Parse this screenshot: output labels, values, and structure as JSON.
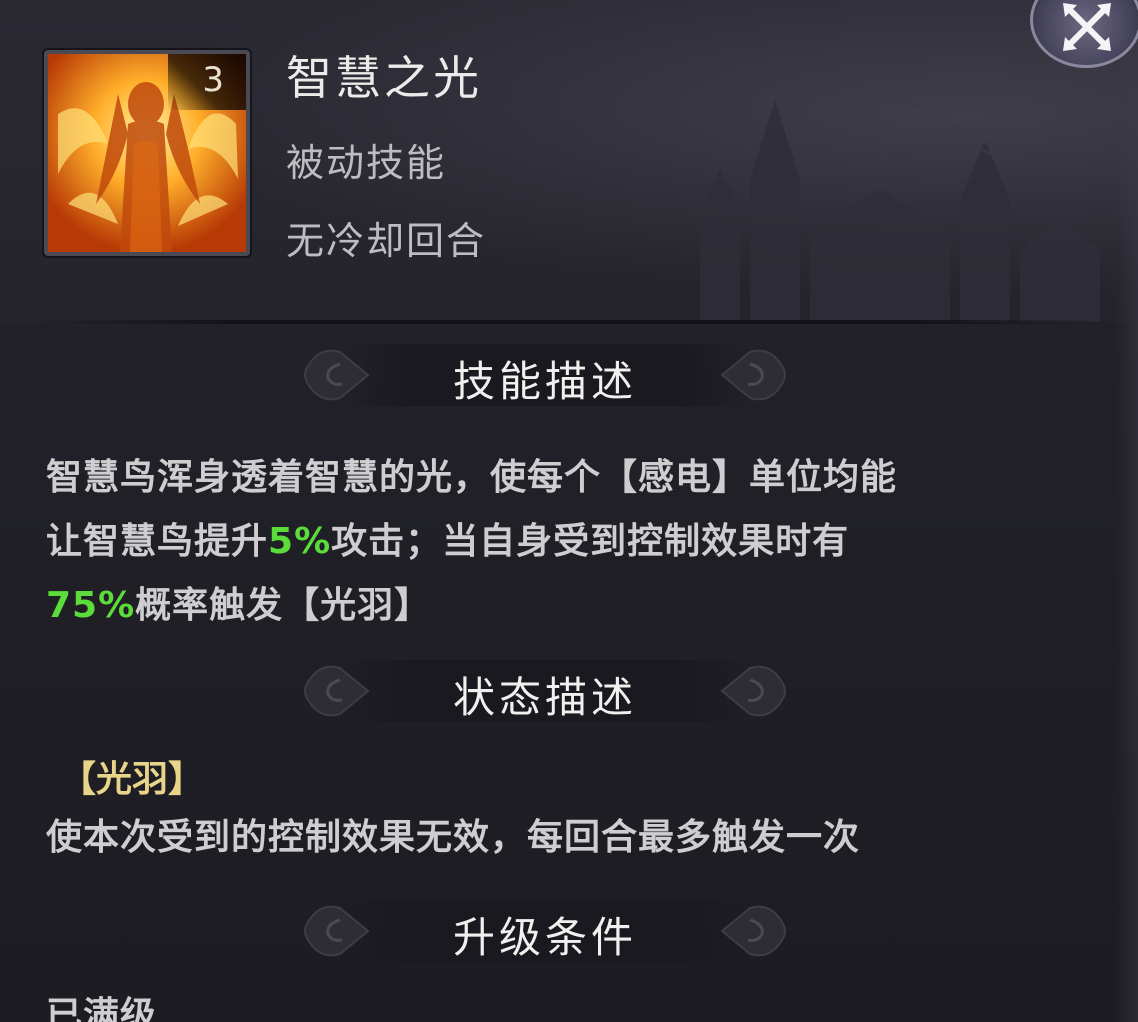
{
  "skill": {
    "level": "3",
    "name": "智慧之光",
    "type": "被动技能",
    "cooldown": "无冷却回合",
    "icon": "fire-phoenix-woman-icon"
  },
  "sections": {
    "description_title": "技能描述",
    "status_title": "状态描述",
    "upgrade_title": "升级条件"
  },
  "description": {
    "line1": "智慧鸟浑身透着智慧的光，使每个【感电】单位均能",
    "line2_prefix": "让智慧鸟提升",
    "line2_highlight": "5%",
    "line2_suffix": "攻击；当自身受到控制效果时有",
    "line3_highlight": "75%",
    "line3_suffix": "概率触发【光羽】"
  },
  "status": {
    "name": "【光羽】",
    "text": "使本次受到的控制效果无效，每回合最多触发一次"
  },
  "upgrade": {
    "text": "已满级"
  },
  "colors": {
    "highlight": "#5cdc3a",
    "status_name": "#e8d58a",
    "text": "#cfcdd0"
  }
}
